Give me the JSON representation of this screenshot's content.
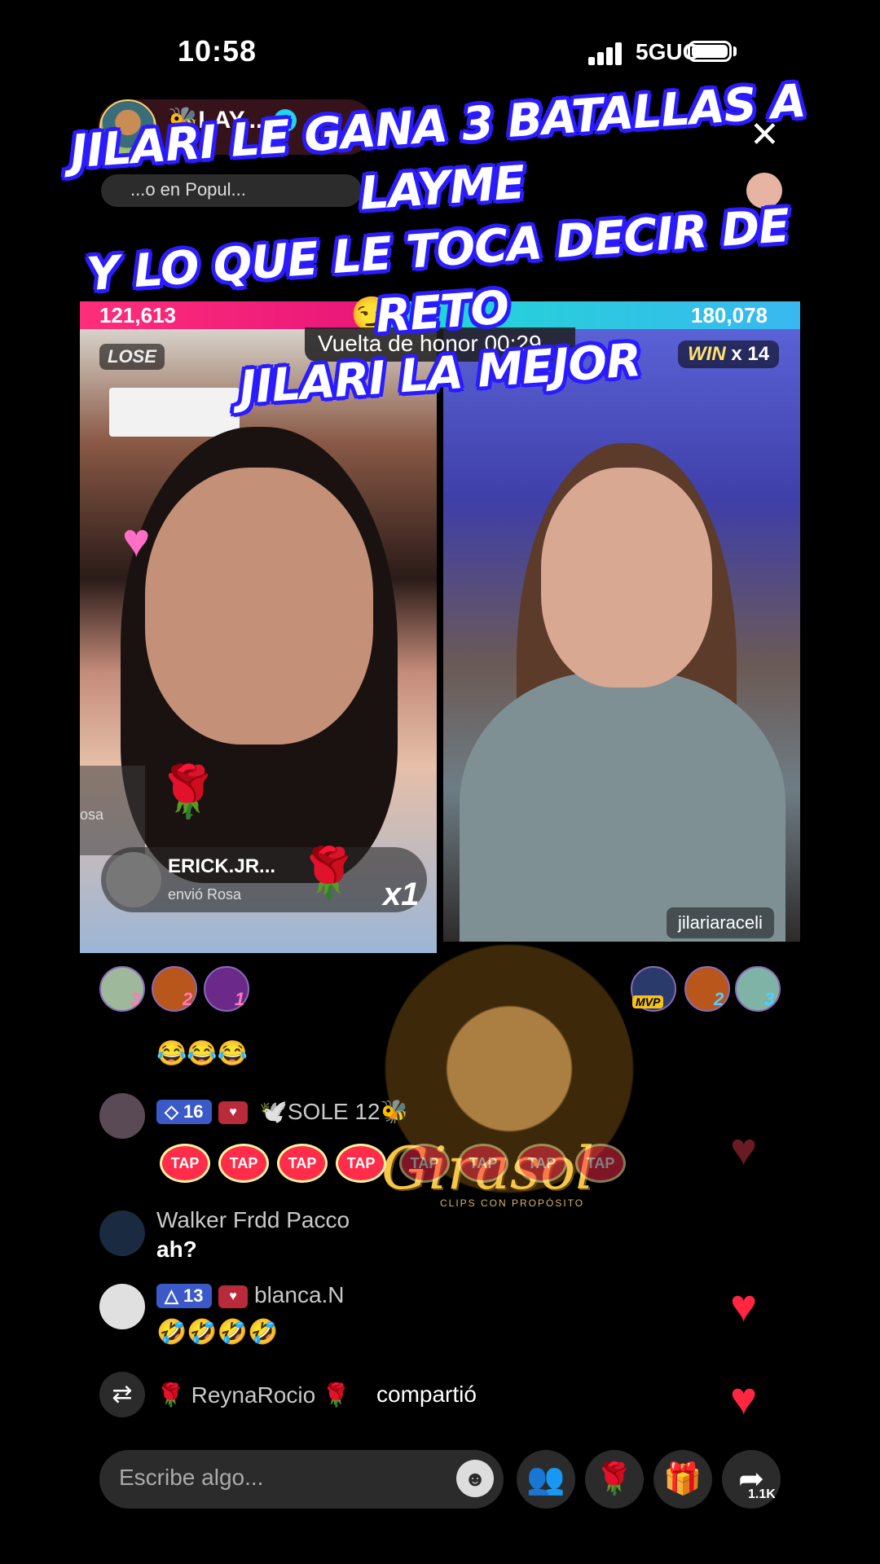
{
  "status": {
    "time": "10:58",
    "network": "5GUC"
  },
  "host": {
    "name": "🐝LAY...",
    "rank_text": "...o en Popul..."
  },
  "caption": {
    "line1": "JILARI LE GANA 3 BATALLAS A LAYME",
    "line2": "Y LO QUE LE TOCA DECIR DE RETO",
    "line3": "JILARI LA MEJOR"
  },
  "battle": {
    "score_left": "121,613",
    "score_right": "180,078",
    "honor_text": "Vuelta de honor 00:29",
    "lose_label": "LOSE",
    "win_label": "WIN",
    "win_count": "x 14",
    "right_username": "jilariaraceli",
    "colors": {
      "left": "#ff2e7a",
      "right": "#1fd9d0"
    }
  },
  "gift": {
    "sender": "ERICK.JR...",
    "action": "envió Rosa",
    "count": "x1",
    "side_label": "osa"
  },
  "gifters_left": [
    {
      "rank": "3"
    },
    {
      "rank": "2"
    },
    {
      "rank": "1"
    }
  ],
  "gifters_right": [
    {
      "rank": "MVP"
    },
    {
      "rank": "2"
    },
    {
      "rank": "3"
    }
  ],
  "chat": [
    {
      "name": "",
      "message": "😂😂😂"
    },
    {
      "level": "16",
      "name": "🕊️SOLE 12🐝",
      "message": "TAP"
    },
    {
      "name": "Walker Frdd Pacco",
      "message": "ah?"
    },
    {
      "level": "13",
      "name": "blanca.N",
      "message": "🤣🤣🤣🤣"
    },
    {
      "name": "🌹 ReynaRocio 🌹",
      "message": "compartió"
    }
  ],
  "watermark": {
    "title": "Girasol",
    "subtitle": "CLIPS CON PROPÓSITO"
  },
  "bottom": {
    "placeholder": "Escribe algo...",
    "share_count": "1.1K"
  }
}
